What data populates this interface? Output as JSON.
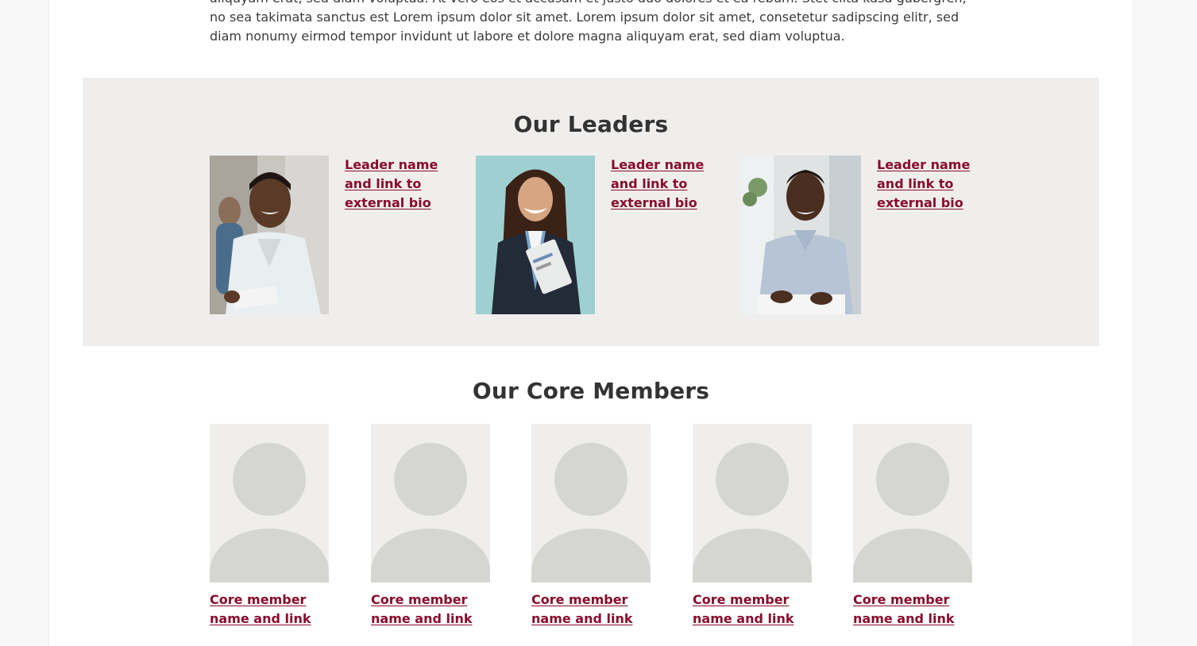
{
  "intro": {
    "text": "aliquyam erat, sed diam voluptua. At vero eos et accusam et justo duo dolores et ea rebum. Stet clita kasd gubergren, no sea takimata sanctus est Lorem ipsum dolor sit amet. Lorem ipsum dolor sit amet, consetetur sadipscing elitr, sed diam nonumy eirmod tempor invidunt ut labore et dolore magna aliquyam erat, sed diam voluptua."
  },
  "leaders": {
    "title": "Our Leaders",
    "items": [
      {
        "link_text": "Leader name and link to external bio",
        "photo": "leader-photo-man-white-shirt"
      },
      {
        "link_text": "Leader name and link to external bio",
        "photo": "leader-photo-woman-blazer"
      },
      {
        "link_text": "Leader name and link to external bio",
        "photo": "leader-photo-man-blue-shirt"
      }
    ]
  },
  "core": {
    "title": "Our Core Members",
    "items": [
      {
        "link_text": "Core member name and link",
        "photo": "placeholder-avatar"
      },
      {
        "link_text": "Core member name and link",
        "photo": "placeholder-avatar"
      },
      {
        "link_text": "Core member name and link",
        "photo": "placeholder-avatar"
      },
      {
        "link_text": "Core member name and link",
        "photo": "placeholder-avatar"
      },
      {
        "link_text": "Core member name and link",
        "photo": "placeholder-avatar"
      }
    ]
  },
  "colors": {
    "link": "#8a0b2c",
    "band_bg": "#efeeec",
    "placeholder_shape": "#d5d5d1"
  }
}
